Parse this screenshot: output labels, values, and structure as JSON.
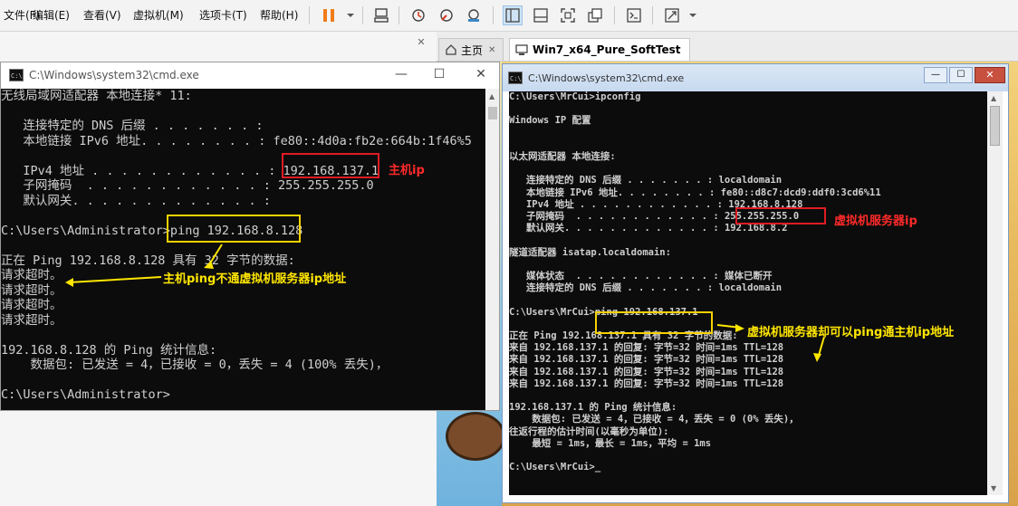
{
  "menubar": {
    "items": [
      "文件(F)",
      "编辑(E)",
      "查看(V)",
      "虚拟机(M)",
      "选项卡(T)",
      "帮助(H)"
    ]
  },
  "tabs": {
    "home": "主页",
    "vm": "Win7_x64_Pure_SoftTest"
  },
  "colors": {
    "annotation_red": "#e01b24",
    "annotation_yellow": "#f5d100",
    "console_bg": "#0c0c0c"
  },
  "left_cmd": {
    "title": "C:\\Windows\\system32\\cmd.exe",
    "lines": [
      "无线局域网适配器 本地连接* 11:",
      "",
      "   连接特定的 DNS 后缀 . . . . . . . :",
      "   本地链接 IPv6 地址. . . . . . . . : fe80::4d0a:fb2e:664b:1f46%5",
      "",
      "   IPv4 地址 . . . . . . . . . . . . : 192.168.137.1",
      "   子网掩码  . . . . . . . . . . . . : 255.255.255.0",
      "   默认网关. . . . . . . . . . . . . :",
      "",
      "C:\\Users\\Administrator>ping 192.168.8.128",
      "",
      "正在 Ping 192.168.8.128 具有 32 字节的数据:",
      "请求超时。",
      "请求超时。",
      "请求超时。",
      "请求超时。",
      "",
      "192.168.8.128 的 Ping 统计信息:",
      "    数据包: 已发送 = 4，已接收 = 0，丢失 = 4 (100% 丢失)，",
      "",
      "C:\\Users\\Administrator>"
    ],
    "annotation_ip": "主机ip",
    "annotation_ping": "主机ping不通虚拟机服务器ip地址"
  },
  "right_cmd": {
    "title": "C:\\Windows\\system32\\cmd.exe",
    "lines": [
      "C:\\Users\\MrCui>ipconfig",
      "",
      "Windows IP 配置",
      "",
      "",
      "以太网适配器 本地连接:",
      "",
      "   连接特定的 DNS 后缀 . . . . . . . : localdomain",
      "   本地链接 IPv6 地址. . . . . . . . : fe80::d8c7:dcd9:ddf0:3cd6%11",
      "   IPv4 地址 . . . . . . . . . . . . : 192.168.8.128",
      "   子网掩码  . . . . . . . . . . . . : 255.255.255.0",
      "   默认网关. . . . . . . . . . . . . : 192.168.8.2",
      "",
      "隧道适配器 isatap.localdomain:",
      "",
      "   媒体状态  . . . . . . . . . . . . : 媒体已断开",
      "   连接特定的 DNS 后缀 . . . . . . . : localdomain",
      "",
      "C:\\Users\\MrCui>ping 192.168.137.1",
      "",
      "正在 Ping 192.168.137.1 具有 32 字节的数据:",
      "来自 192.168.137.1 的回复: 字节=32 时间=1ms TTL=128",
      "来自 192.168.137.1 的回复: 字节=32 时间=1ms TTL=128",
      "来自 192.168.137.1 的回复: 字节=32 时间=1ms TTL=128",
      "来自 192.168.137.1 的回复: 字节=32 时间=1ms TTL=128",
      "",
      "192.168.137.1 的 Ping 统计信息:",
      "    数据包: 已发送 = 4，已接收 = 4，丢失 = 0 (0% 丢失)，",
      "往返行程的估计时间(以毫秒为单位):",
      "    最短 = 1ms，最长 = 1ms，平均 = 1ms",
      "",
      "C:\\Users\\MrCui>_"
    ],
    "annotation_ip": "虚拟机服务器ip",
    "annotation_ping": "虚拟机服务器却可以ping通主机ip地址"
  }
}
